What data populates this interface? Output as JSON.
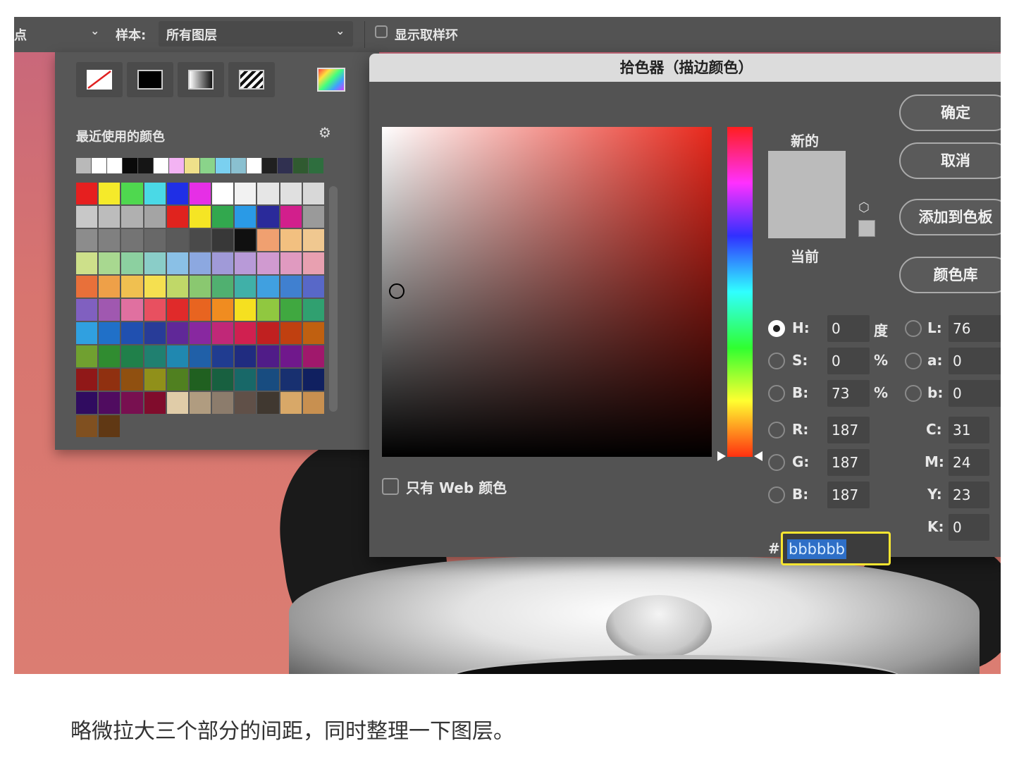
{
  "options_bar": {
    "point_label": "点",
    "sample_label": "样本:",
    "sample_value": "所有图层",
    "show_ring_label": "显示取样环"
  },
  "swatches": {
    "recent_title": "最近使用的颜色",
    "recent_colors": [
      "#b9b9b9",
      "#ffffff",
      "#ffffff",
      "#0a0a0a",
      "#151515",
      "#ffffff",
      "#f3b3f3",
      "#efe08a",
      "#8ad48a",
      "#7ad0f0",
      "#8ac0d0",
      "#ffffff",
      "#202020",
      "#303050",
      "#305a30",
      "#2e6e3e"
    ],
    "grid_colors": [
      "#e61f1f",
      "#f5ea2a",
      "#4fd84f",
      "#4ad9e6",
      "#1f2fe6",
      "#e62fe6",
      "#ffffff",
      "#f2f2f2",
      "#e6e6e6",
      "#e0e0e0",
      "#d8d8d8",
      "#c8c8c8",
      "#bcbcbc",
      "#b0b0b0",
      "#a4a4a4",
      "#e0231e",
      "#f5e524",
      "#32a84e",
      "#2a9ae6",
      "#2a2a9a",
      "#d21f8c",
      "#9a9a9a",
      "#8c8c8c",
      "#808080",
      "#747474",
      "#686868",
      "#5a5a5a",
      "#4a4a4a",
      "#383838",
      "#101010",
      "#f0a070",
      "#f2c080",
      "#f0c890",
      "#cde08a",
      "#a8d890",
      "#8cd0a0",
      "#8acdc8",
      "#8ac0e6",
      "#8ca8e0",
      "#a09ad8",
      "#b89ad8",
      "#d09ad0",
      "#e09ac0",
      "#e8a0b0",
      "#e8703a",
      "#eea048",
      "#f0c050",
      "#f5e050",
      "#c0d868",
      "#8ac870",
      "#50b070",
      "#40b0a8",
      "#40a0e0",
      "#4080d0",
      "#5868c8",
      "#8060c0",
      "#a058b0",
      "#e070a0",
      "#e85060",
      "#e02a2a",
      "#e86420",
      "#f08c20",
      "#f5e020",
      "#90c840",
      "#40a840",
      "#30a070",
      "#30a0e0",
      "#2070c8",
      "#2050b0",
      "#283c98",
      "#602898",
      "#8828a0",
      "#c02878",
      "#d02050",
      "#c02020",
      "#c04010",
      "#c06010",
      "#70a030",
      "#308c30",
      "#20804a",
      "#208070",
      "#2088b0",
      "#2060a8",
      "#203c90",
      "#202c80",
      "#501c88",
      "#70188c",
      "#a0186c",
      "#901818",
      "#903010",
      "#905010",
      "#90901a",
      "#508020",
      "#206020",
      "#186040",
      "#186868",
      "#184c80",
      "#183070",
      "#102060",
      "#300c60",
      "#500c60",
      "#781050",
      "#800c2c",
      "#e0cca8",
      "#b09c80",
      "#8c7c6c",
      "#605048",
      "#403830",
      "#d8a868",
      "#c89050",
      "#805020",
      "#603814"
    ]
  },
  "dialog": {
    "title": "拾色器（描边颜色）",
    "new_label": "新的",
    "current_label": "当前",
    "new_color": "#bbbbbb",
    "buttons": {
      "ok": "确定",
      "cancel": "取消",
      "add_to_swatches": "添加到色板",
      "color_libraries": "颜色库"
    },
    "web_only_label": "只有 Web 颜色",
    "hsb": {
      "h": {
        "label": "H:",
        "value": "0",
        "unit": "度"
      },
      "s": {
        "label": "S:",
        "value": "0",
        "unit": "%"
      },
      "b": {
        "label": "B:",
        "value": "73",
        "unit": "%"
      }
    },
    "rgb": {
      "r": {
        "label": "R:",
        "value": "187"
      },
      "g": {
        "label": "G:",
        "value": "187"
      },
      "b": {
        "label": "B:",
        "value": "187"
      }
    },
    "lab": {
      "l": {
        "label": "L:",
        "value": "76"
      },
      "a": {
        "label": "a:",
        "value": "0"
      },
      "b": {
        "label": "b:",
        "value": "0"
      }
    },
    "cmyk": {
      "c": {
        "label": "C:",
        "value": "31"
      },
      "m": {
        "label": "M:",
        "value": "24"
      },
      "y": {
        "label": "Y:",
        "value": "23"
      },
      "k": {
        "label": "K:",
        "value": "0"
      }
    },
    "hex_label": "#",
    "hex_value": "bbbbbb"
  },
  "caption": "略微拉大三个部分的间距，同时整理一下图层。"
}
